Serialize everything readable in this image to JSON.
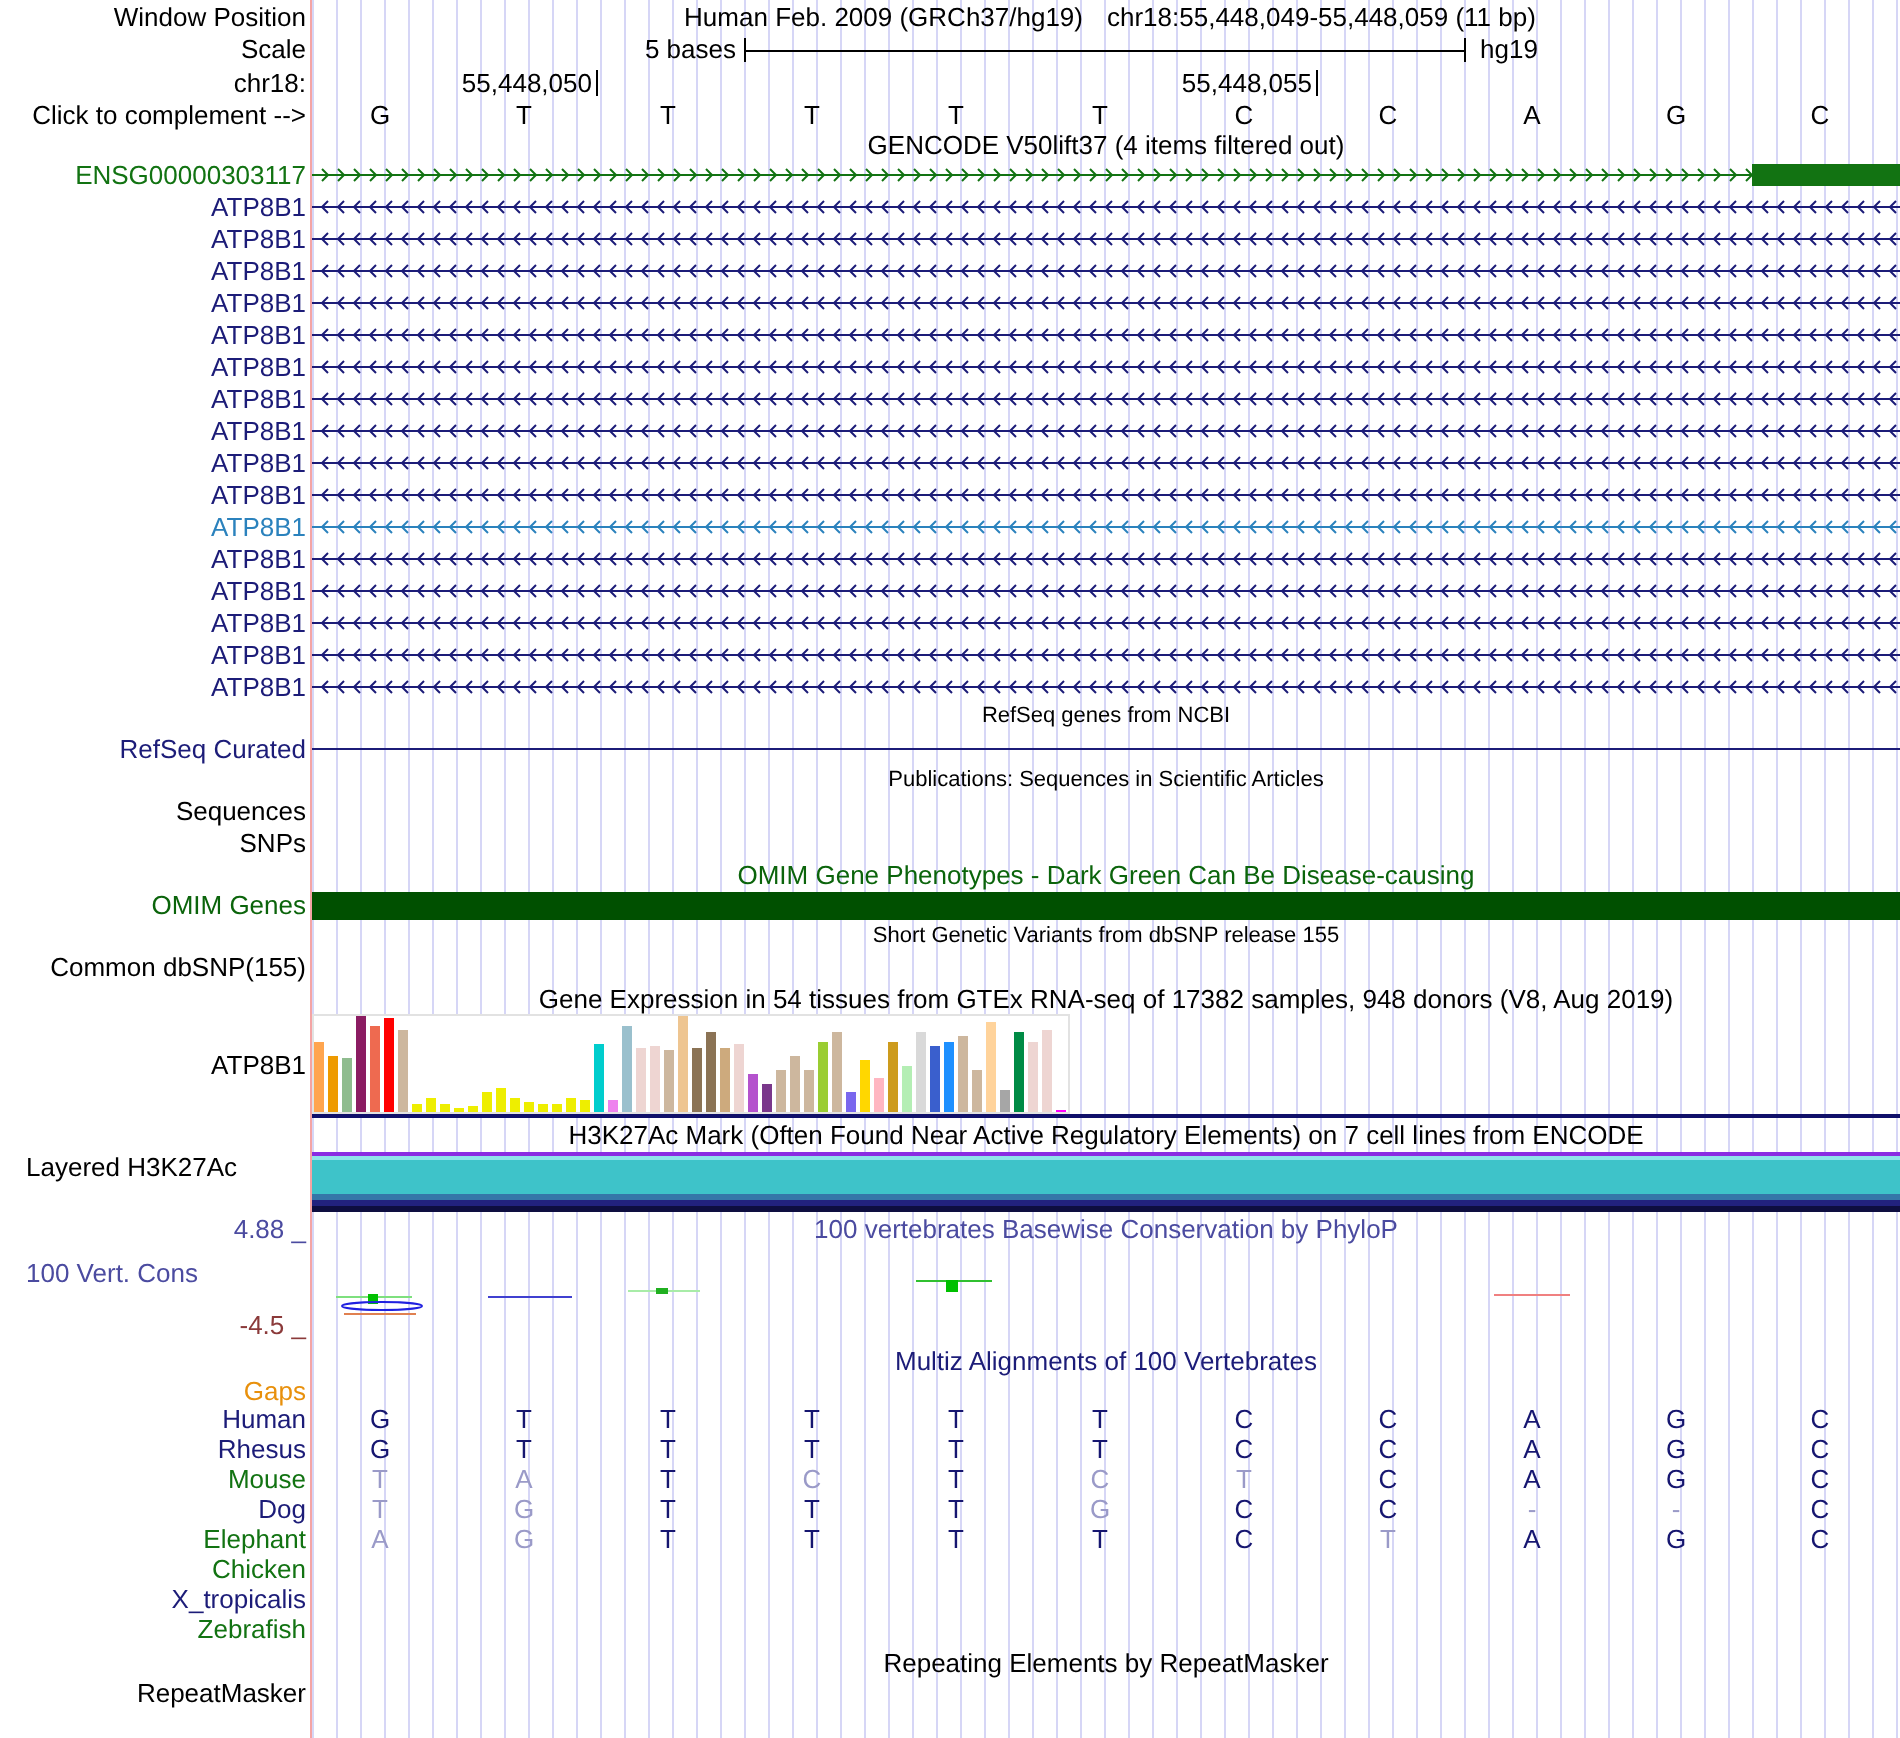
{
  "position_bar": {
    "label": "Window Position",
    "assembly": "Human Feb. 2009 (GRCh37/hg19)",
    "range": "chr18:55,448,049-55,448,059 (11 bp)"
  },
  "scale": {
    "label": "Scale",
    "length": "5 bases",
    "assembly": "hg19"
  },
  "coordinate_ruler": {
    "label": "chr18:",
    "positions": [
      "55,448,050",
      "55,448,055"
    ]
  },
  "sequence": {
    "label": "Click to complement -->",
    "bases": [
      "G",
      "T",
      "T",
      "T",
      "T",
      "T",
      "C",
      "C",
      "A",
      "G",
      "C"
    ]
  },
  "gencode": {
    "title": "GENCODE V50lift37 (4 items filtered out)",
    "transcripts": [
      {
        "name": "ENSG00000303117",
        "color": "#127312",
        "reverse": false,
        "exon_block": true
      },
      {
        "name": "ATP8B1",
        "color": "#1c1c78",
        "reverse": true,
        "exon_block": false
      },
      {
        "name": "ATP8B1",
        "color": "#1c1c78",
        "reverse": true,
        "exon_block": false
      },
      {
        "name": "ATP8B1",
        "color": "#1c1c78",
        "reverse": true,
        "exon_block": false
      },
      {
        "name": "ATP8B1",
        "color": "#1c1c78",
        "reverse": true,
        "exon_block": false
      },
      {
        "name": "ATP8B1",
        "color": "#1c1c78",
        "reverse": true,
        "exon_block": false
      },
      {
        "name": "ATP8B1",
        "color": "#1c1c78",
        "reverse": true,
        "exon_block": false
      },
      {
        "name": "ATP8B1",
        "color": "#1c1c78",
        "reverse": true,
        "exon_block": false
      },
      {
        "name": "ATP8B1",
        "color": "#1c1c78",
        "reverse": true,
        "exon_block": false
      },
      {
        "name": "ATP8B1",
        "color": "#1c1c78",
        "reverse": true,
        "exon_block": false
      },
      {
        "name": "ATP8B1",
        "color": "#1c1c78",
        "reverse": true,
        "exon_block": false
      },
      {
        "name": "ATP8B1",
        "color": "#2b82bd",
        "reverse": true,
        "exon_block": false
      },
      {
        "name": "ATP8B1",
        "color": "#1c1c78",
        "reverse": true,
        "exon_block": false
      },
      {
        "name": "ATP8B1",
        "color": "#1c1c78",
        "reverse": true,
        "exon_block": false
      },
      {
        "name": "ATP8B1",
        "color": "#1c1c78",
        "reverse": true,
        "exon_block": false
      },
      {
        "name": "ATP8B1",
        "color": "#1c1c78",
        "reverse": true,
        "exon_block": false
      },
      {
        "name": "ATP8B1",
        "color": "#1c1c78",
        "reverse": true,
        "exon_block": false
      }
    ]
  },
  "refseq": {
    "title": "RefSeq genes from NCBI",
    "label": "RefSeq Curated"
  },
  "publications": {
    "title": "Publications: Sequences in Scientific Articles",
    "labels": [
      "Sequences",
      "SNPs"
    ]
  },
  "omim": {
    "title": "OMIM Gene Phenotypes - Dark Green Can Be Disease-causing",
    "label": "OMIM Genes"
  },
  "dbsnp": {
    "title": "Short Genetic Variants from dbSNP release 155",
    "label": "Common dbSNP(155)"
  },
  "gtex": {
    "title": "Gene Expression in 54 tissues from GTEx RNA-seq of 17382 samples, 948 donors (V8, Aug 2019)",
    "label": "ATP8B1"
  },
  "h3k27ac": {
    "title": "H3K27Ac Mark (Often Found Near Active Regulatory Elements) on 7 cell lines from ENCODE",
    "label": "Layered H3K27Ac"
  },
  "phylop": {
    "title": "100 vertebrates Basewise Conservation by PhyloP",
    "label": "100 Vert. Cons",
    "axis_max": "4.88 _",
    "axis_min": "-4.5 _"
  },
  "multiz": {
    "title": "Multiz Alignments of 100 Vertebrates",
    "gaps_label": "Gaps",
    "species": [
      {
        "name": "Human",
        "color": "#1c1c78",
        "bases": [
          {
            "base": "G",
            "match": true
          },
          {
            "base": "T",
            "match": true
          },
          {
            "base": "T",
            "match": true
          },
          {
            "base": "T",
            "match": true
          },
          {
            "base": "T",
            "match": true
          },
          {
            "base": "T",
            "match": true
          },
          {
            "base": "C",
            "match": true
          },
          {
            "base": "C",
            "match": true
          },
          {
            "base": "A",
            "match": true
          },
          {
            "base": "G",
            "match": true
          },
          {
            "base": "C",
            "match": true
          }
        ]
      },
      {
        "name": "Rhesus",
        "color": "#1c1c78",
        "bases": [
          {
            "base": "G",
            "match": true
          },
          {
            "base": "T",
            "match": true
          },
          {
            "base": "T",
            "match": true
          },
          {
            "base": "T",
            "match": true
          },
          {
            "base": "T",
            "match": true
          },
          {
            "base": "T",
            "match": true
          },
          {
            "base": "C",
            "match": true
          },
          {
            "base": "C",
            "match": true
          },
          {
            "base": "A",
            "match": true
          },
          {
            "base": "G",
            "match": true
          },
          {
            "base": "C",
            "match": true
          }
        ]
      },
      {
        "name": "Mouse",
        "color": "#127312",
        "bases": [
          {
            "base": "T",
            "match": false
          },
          {
            "base": "A",
            "match": false
          },
          {
            "base": "T",
            "match": true
          },
          {
            "base": "C",
            "match": false
          },
          {
            "base": "T",
            "match": true
          },
          {
            "base": "C",
            "match": false
          },
          {
            "base": "T",
            "match": false
          },
          {
            "base": "C",
            "match": true
          },
          {
            "base": "A",
            "match": true
          },
          {
            "base": "G",
            "match": true
          },
          {
            "base": "C",
            "match": true
          }
        ]
      },
      {
        "name": "Dog",
        "color": "#1c1c78",
        "bases": [
          {
            "base": "T",
            "match": false
          },
          {
            "base": "G",
            "match": false
          },
          {
            "base": "T",
            "match": true
          },
          {
            "base": "T",
            "match": true
          },
          {
            "base": "T",
            "match": true
          },
          {
            "base": "G",
            "match": false
          },
          {
            "base": "C",
            "match": true
          },
          {
            "base": "C",
            "match": true
          },
          {
            "base": "-",
            "match": false
          },
          {
            "base": "-",
            "match": false
          },
          {
            "base": "C",
            "match": true
          }
        ]
      },
      {
        "name": "Elephant",
        "color": "#127312",
        "bases": [
          {
            "base": "A",
            "match": false
          },
          {
            "base": "G",
            "match": false
          },
          {
            "base": "T",
            "match": true
          },
          {
            "base": "T",
            "match": true
          },
          {
            "base": "T",
            "match": true
          },
          {
            "base": "T",
            "match": true
          },
          {
            "base": "C",
            "match": true
          },
          {
            "base": "T",
            "match": false
          },
          {
            "base": "A",
            "match": true
          },
          {
            "base": "G",
            "match": true
          },
          {
            "base": "C",
            "match": true
          }
        ]
      },
      {
        "name": "Chicken",
        "color": "#127312"
      },
      {
        "name": "X_tropicalis",
        "color": "#1c1c78"
      },
      {
        "name": "Zebrafish",
        "color": "#127312"
      }
    ]
  },
  "repeatmasker": {
    "title": "Repeating Elements by RepeatMasker",
    "label": "RepeatMasker"
  }
}
